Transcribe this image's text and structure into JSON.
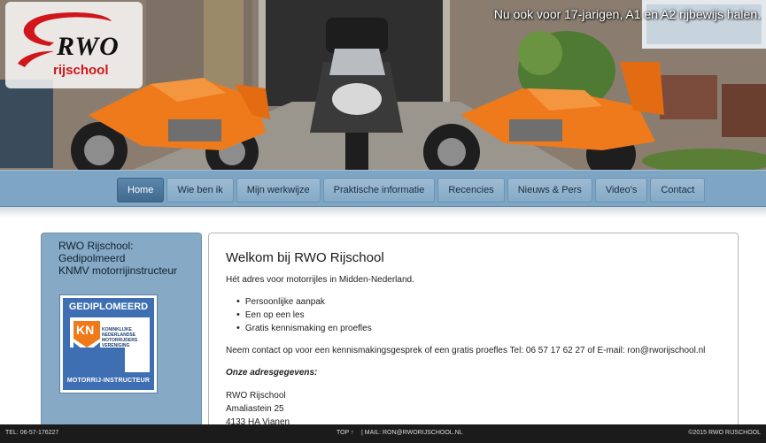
{
  "header": {
    "logo_brand": "RWO",
    "logo_sub": "rijschool",
    "tagline": "Nu ook voor 17-jarigen, A1 en A2 rijbewijs halen."
  },
  "nav": {
    "items": [
      {
        "label": "Home",
        "active": true
      },
      {
        "label": "Wie ben ik"
      },
      {
        "label": "Mijn werkwijze"
      },
      {
        "label": "Praktische informatie"
      },
      {
        "label": "Recencies"
      },
      {
        "label": "Nieuws & Pers"
      },
      {
        "label": "Video's"
      },
      {
        "label": "Contact"
      }
    ]
  },
  "sidebar": {
    "lines": [
      "RWO Rijschool:",
      "Gedipolmeerd",
      "KNMV motorrijinstructeur"
    ],
    "badge_top": "GEDIPLOMEERD",
    "badge_bottom": "MOTORRIJ-INSTRUCTEUR",
    "badge_org": "KONINKLIJKE NEDERLANDSE MOTORRIJDERS VERENIGING",
    "badge_letters": "KN"
  },
  "main": {
    "title": "Welkom bij RWO Rijschool",
    "intro": "Hét adres voor motorrijles in Midden-Nederland.",
    "bullets": [
      "Persoonlijke aanpak",
      "Een op een les",
      "Gratis kennismaking en proefles"
    ],
    "contact": "Neem contact op voor een kennismakingsgesprek of een gratis proefles Tel: 06 57 17 62 27 of E-mail: ron@rworijschool.nl",
    "address_heading": "Onze adresgegevens:",
    "address": [
      "RWO Rijschool",
      "Amaliastein 25",
      "4133 HA Vianen"
    ]
  },
  "footer": {
    "phone": "TEL: 06-57-176227",
    "top": "TOP ↑",
    "mail": "| MAIL: RON@RWORIJSCHOOL.NL",
    "copyright": "©2015 RWO RIJSCHOOL"
  },
  "colors": {
    "nav_bar": "#7ea6c4",
    "nav_active": "#40698d",
    "logo_red": "#d0161b",
    "motorcycle_orange": "#f07a1a",
    "footer": "#1b1b1b"
  }
}
